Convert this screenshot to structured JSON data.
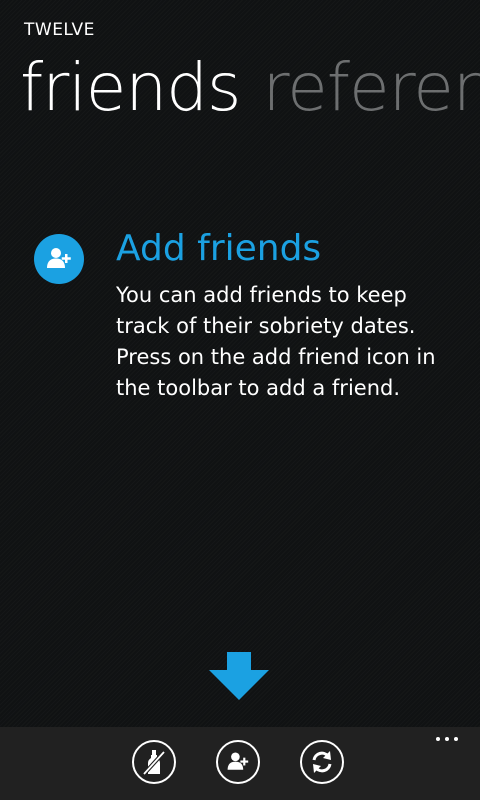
{
  "app": {
    "title": "TWELVE"
  },
  "pivot": {
    "headers": [
      {
        "label": "friends",
        "active": true
      },
      {
        "label": "referenc",
        "active": false
      }
    ]
  },
  "empty_state": {
    "heading": "Add friends",
    "text": "You can add friends to keep track of their sobriety dates. Press on the add friend icon in the toolbar to add a friend."
  },
  "appbar": {
    "buttons": [
      {
        "icon": "no-bottle-icon"
      },
      {
        "icon": "add-friend-icon"
      },
      {
        "icon": "refresh-icon"
      }
    ],
    "more_icon": "ellipsis-icon"
  },
  "colors": {
    "accent": "#1ba1e2",
    "background": "#101213",
    "appbar": "#212121",
    "inactive_header": "#6d6f70"
  }
}
